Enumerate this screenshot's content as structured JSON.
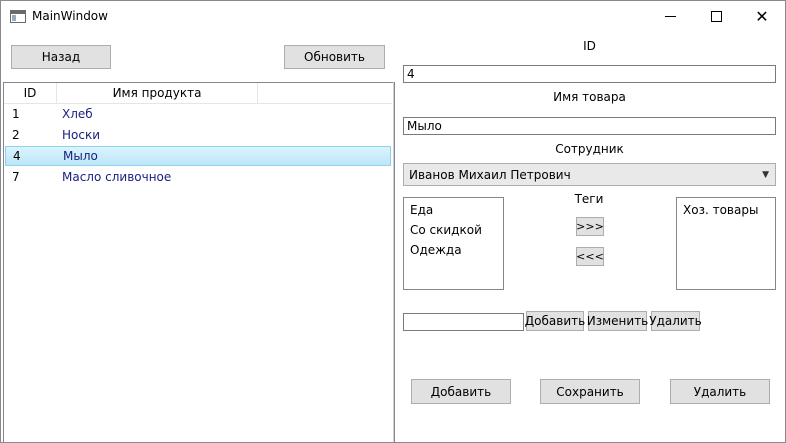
{
  "window": {
    "title": "MainWindow",
    "close_glyph": "✕"
  },
  "toolbar": {
    "back_label": "Назад",
    "refresh_label": "Обновить"
  },
  "table": {
    "columns": [
      "ID",
      "Имя продукта"
    ],
    "rows": [
      {
        "id": "1",
        "name": "Хлеб",
        "selected": false
      },
      {
        "id": "2",
        "name": "Носки",
        "selected": false
      },
      {
        "id": "4",
        "name": "Мыло",
        "selected": true
      },
      {
        "id": "7",
        "name": "Масло сливочное",
        "selected": false
      }
    ]
  },
  "form": {
    "id_label": "ID",
    "id_value": "4",
    "name_label": "Имя товара",
    "name_value": "Мыло",
    "employee_label": "Сотрудник",
    "employee_value": "Иванов Михаил Петрович",
    "tags_label": "Теги",
    "available_tags": [
      "Еда",
      "Со скидкой",
      "Одежда"
    ],
    "selected_tags": [
      "Хоз. товары"
    ],
    "move_right_label": ">>>",
    "move_left_label": "<<<",
    "tag_input_value": "",
    "tag_add_label": "Добавить",
    "tag_edit_label": "Изменить",
    "tag_delete_label": "Удалить",
    "add_label": "Добавить",
    "save_label": "Сохранить",
    "delete_label": "Удалить"
  },
  "colors": {
    "selection": "#cce8f6",
    "button_bg": "#e1e1e1",
    "link_text": "#1a237e"
  }
}
